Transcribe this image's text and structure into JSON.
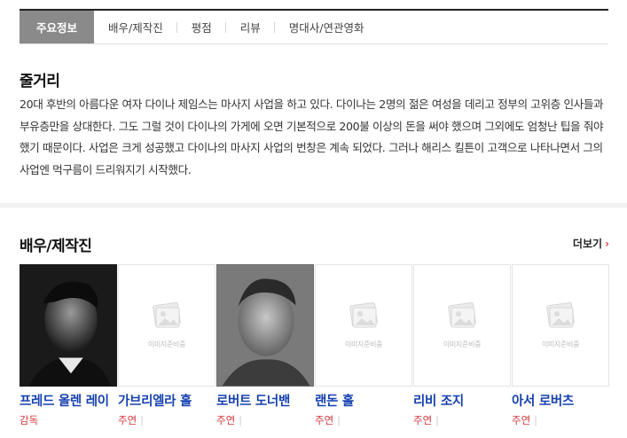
{
  "tabs": [
    {
      "label": "주요정보",
      "active": true
    },
    {
      "label": "배우/제작진",
      "active": false
    },
    {
      "label": "평점",
      "active": false
    },
    {
      "label": "리뷰",
      "active": false
    },
    {
      "label": "명대사/연관영화",
      "active": false
    }
  ],
  "synopsis": {
    "title": "줄거리",
    "text": "20대 후반의 아름다운 여자 다이나 제임스는 마사지 사업을 하고 있다. 다이나는 2명의 젊은 여성을 데리고 정부의 고위층 인사들과 부유층만을 상대한다. 그도 그럴 것이 다이나의 가게에 오면 기본적으로 200불 이상의 돈을 써야 했으며 그외에도 엄청난 팁을 줘야 했기 때문이다. 사업은 크게 성공했고 다이나의 마사지 사업의 번창은 계속 되었다. 그러나 해리스 킬튼이 고객으로 나타나면서 그의 사업엔 먹구름이 드리워지기 시작했다."
  },
  "cast_section": {
    "title": "배우/제작진",
    "more_label": "더보기",
    "placeholder_text": "이미지준비중",
    "members": [
      {
        "name": "프레드 올렌 레이",
        "role": "감독",
        "has_photo": true
      },
      {
        "name": "가브리엘라 홀",
        "role": "주연",
        "has_photo": false
      },
      {
        "name": "로버트 도너밴",
        "role": "주연",
        "has_photo": true
      },
      {
        "name": "랜돈 홀",
        "role": "주연",
        "has_photo": false
      },
      {
        "name": "리비 조지",
        "role": "주연",
        "has_photo": false
      },
      {
        "name": "아서 로버츠",
        "role": "주연",
        "has_photo": false
      }
    ]
  },
  "colors": {
    "name_link": "#1540b0",
    "role": "#d4363c",
    "active_tab": "#8a8a8a",
    "more_chevron": "#e0393e"
  }
}
